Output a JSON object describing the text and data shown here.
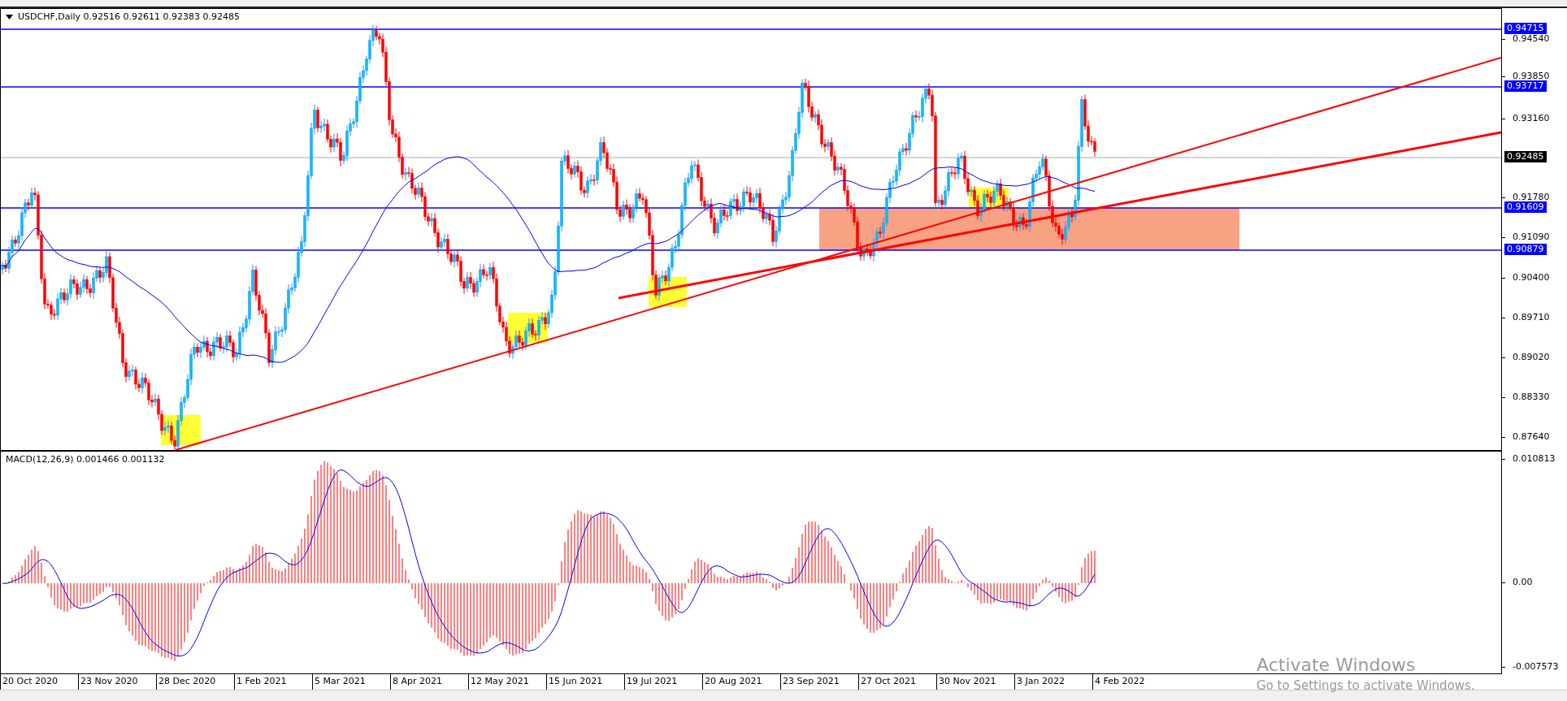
{
  "chart": {
    "header": "USDCHF,Daily 0.92516 0.92611 0.92383 0.92485",
    "price_axis": [
      {
        "label": "0.94715",
        "kind": "level"
      },
      {
        "label": "0.94540",
        "kind": "tick"
      },
      {
        "label": "0.93850",
        "kind": "tick"
      },
      {
        "label": "0.93717",
        "kind": "level"
      },
      {
        "label": "0.93160",
        "kind": "tick"
      },
      {
        "label": "0.92485",
        "kind": "current"
      },
      {
        "label": "0.91780",
        "kind": "tick"
      },
      {
        "label": "0.91609",
        "kind": "level"
      },
      {
        "label": "0.91090",
        "kind": "tick"
      },
      {
        "label": "0.90879",
        "kind": "level"
      },
      {
        "label": "0.90400",
        "kind": "tick"
      },
      {
        "label": "0.89710",
        "kind": "tick"
      },
      {
        "label": "0.89020",
        "kind": "tick"
      },
      {
        "label": "0.88330",
        "kind": "tick"
      },
      {
        "label": "0.87640",
        "kind": "tick"
      }
    ],
    "indicator": {
      "header": "MACD(12,26,9) 0.001466 0.001132",
      "axis": [
        "0.010813",
        "0.00",
        "-0.007573"
      ]
    },
    "dates": [
      "20 Oct 2020",
      "23 Nov 2020",
      "28 Dec 2020",
      "1 Feb 2021",
      "5 Mar 2021",
      "8 Apr 2021",
      "12 May 2021",
      "15 Jun 2021",
      "19 Jul 2021",
      "20 Aug 2021",
      "23 Sep 2021",
      "27 Oct 2021",
      "30 Nov 2021",
      "3 Jan 2022",
      "4 Feb 2022"
    ]
  },
  "os_notice": {
    "title": "Activate Windows",
    "message": "Go to Settings to activate Windows."
  }
}
